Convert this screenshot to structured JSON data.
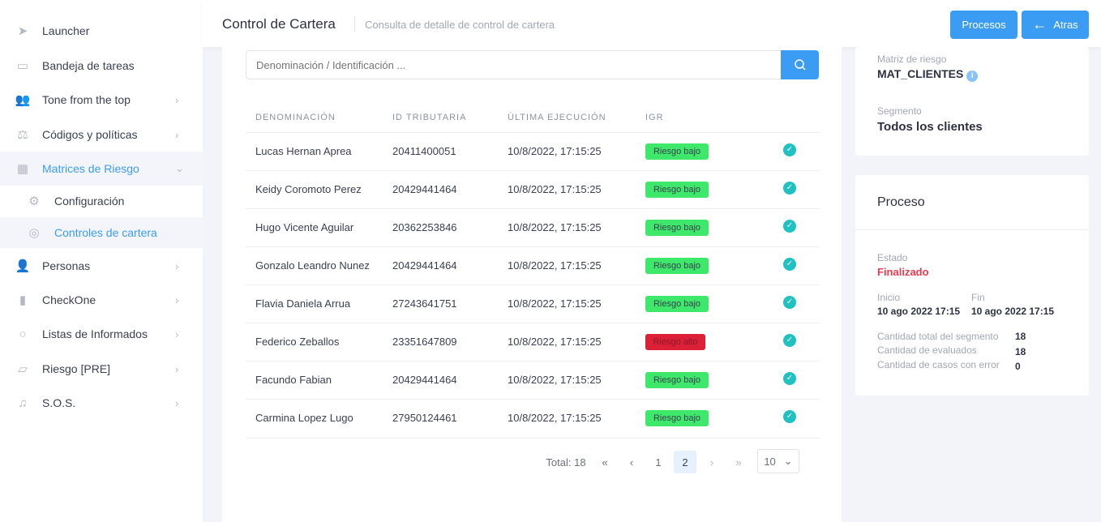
{
  "sidebar": {
    "items": [
      {
        "label": "Launcher",
        "icon": "paper-plane-icon"
      },
      {
        "label": "Bandeja de tareas",
        "icon": "inbox-icon"
      },
      {
        "label": "Tone from the top",
        "icon": "users-icon"
      },
      {
        "label": "Códigos y políticas",
        "icon": "scale-icon"
      },
      {
        "label": "Matrices de Riesgo",
        "icon": "calculator-icon"
      },
      {
        "label": "Configuración",
        "icon": "gear-icon"
      },
      {
        "label": "Controles de cartera",
        "icon": "globe-icon"
      },
      {
        "label": "Personas",
        "icon": "user-tag-icon"
      },
      {
        "label": "CheckOne",
        "icon": "document-icon"
      },
      {
        "label": "Listas de Informados",
        "icon": "search-icon"
      },
      {
        "label": "Riesgo [PRE]",
        "icon": "chart-board-icon"
      },
      {
        "label": "S.O.S.",
        "icon": "bell-icon"
      }
    ]
  },
  "header": {
    "title": "Control de Cartera",
    "subtitle": "Consulta de detalle de control de cartera",
    "procesos": "Procesos",
    "atras": "Atras"
  },
  "search": {
    "placeholder": "Denominación / Identificación ..."
  },
  "table": {
    "headers": [
      "DENOMINACIÓN",
      "ID TRIBUTARIA",
      "ÚLTIMA EJECUCIÓN",
      "IGR"
    ],
    "rows": [
      [
        "Lucas Hernan Aprea",
        "20411400051",
        "10/8/2022, 17:15:25",
        "Riesgo bajo"
      ],
      [
        "Keidy Coromoto Perez",
        "20429441464",
        "10/8/2022, 17:15:25",
        "Riesgo bajo"
      ],
      [
        "Hugo Vicente Aguilar",
        "20362253846",
        "10/8/2022, 17:15:25",
        "Riesgo bajo"
      ],
      [
        "Gonzalo Leandro Nunez",
        "20429441464",
        "10/8/2022, 17:15:25",
        "Riesgo bajo"
      ],
      [
        "Flavia Daniela Arrua",
        "27243641751",
        "10/8/2022, 17:15:25",
        "Riesgo bajo"
      ],
      [
        "Federico Zeballos",
        "23351647809",
        "10/8/2022, 17:15:25",
        "Riesgo alto"
      ],
      [
        "Facundo Fabian",
        "20429441464",
        "10/8/2022, 17:15:25",
        "Riesgo bajo"
      ],
      [
        "Carmina Lopez Lugo",
        "27950124461",
        "10/8/2022, 17:15:25",
        "Riesgo bajo"
      ]
    ]
  },
  "colors": {
    "accent": "#3b9cf3",
    "riesgo_bajo": "#3ee86a",
    "riesgo_alto": "#dc2038",
    "finalizado": "#f0394f"
  },
  "pagination": {
    "total": "Total: 18",
    "first": "«",
    "prev": "‹",
    "pages": [
      "1",
      "2"
    ],
    "current": "2",
    "next": "›",
    "last": "»",
    "page_size": "10"
  },
  "info": {
    "matriz_label": "Matriz de riesgo",
    "matriz": "MAT_CLIENTES",
    "segmento_label": "Segmento",
    "segmento": "Todos los clientes"
  },
  "proceso": {
    "title": "Proceso",
    "estado_label": "Estado",
    "estado": "Finalizado",
    "inicio_label": "Inicio",
    "inicio": "10 ago 2022 17:15",
    "fin_label": "Fin",
    "fin": "10 ago 2022 17:15",
    "total_label": "Cantidad total del segmento",
    "total": "18",
    "evaluados_label": "Cantidad de evaluados",
    "evaluados": "18",
    "error_label": "Cantidad de casos con error",
    "error": "0"
  }
}
